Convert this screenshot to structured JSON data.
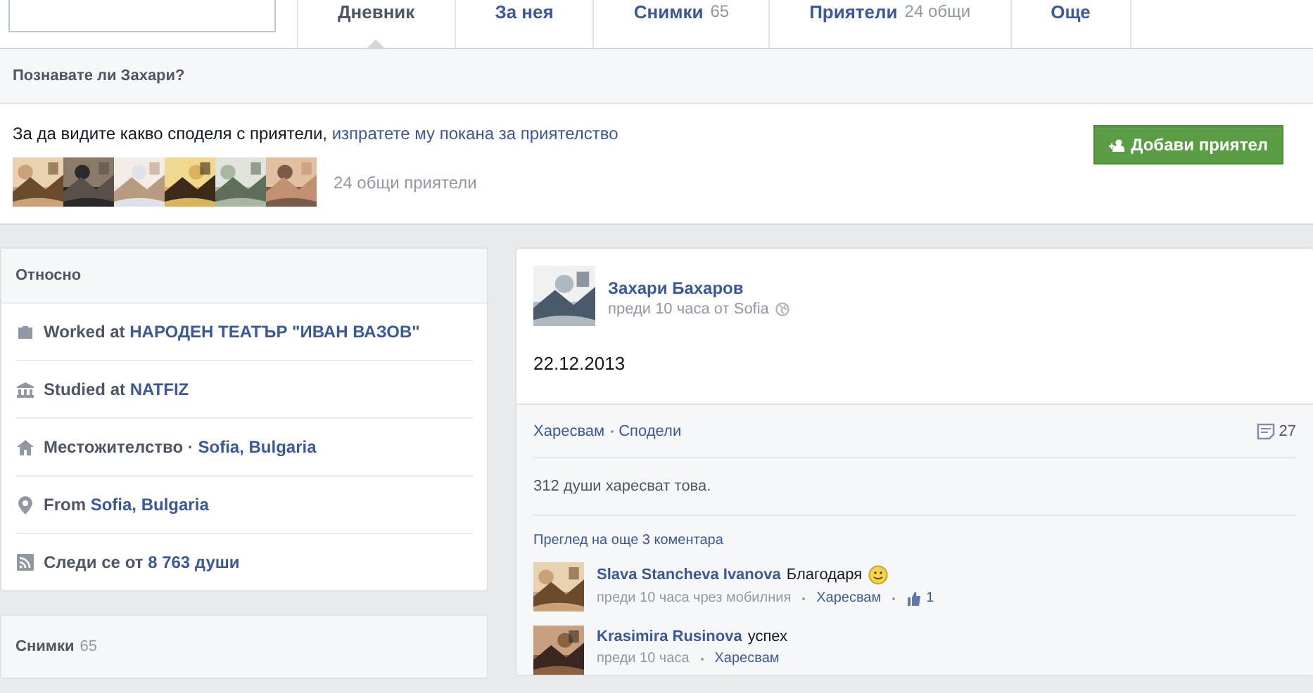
{
  "tabs": [
    {
      "label": "Дневник",
      "selected": true
    },
    {
      "label": "За нея",
      "selected": false
    },
    {
      "label": "Снимки",
      "count": "65",
      "selected": false
    },
    {
      "label": "Приятели",
      "count": "24 общи",
      "selected": false
    },
    {
      "label": "Още",
      "selected": false
    }
  ],
  "know_panel": {
    "title": "Познавате ли Захари?",
    "message": "За да видите какво споделя с приятели,",
    "link": "изпратете му покана за приятелство",
    "button": "Добави приятел",
    "mutual_friends": "24 общи приятели"
  },
  "about": {
    "title": "Относно",
    "items": [
      {
        "kind": "work",
        "text": "Worked at **НАРОДЕН ТЕАТЪР \"ИВАН ВАЗОВ\"**"
      },
      {
        "kind": "school",
        "text": "Studied at **NATFIZ**"
      },
      {
        "kind": "home",
        "text": "Местожителство · **Sofia, Bulgaria**"
      },
      {
        "kind": "pin",
        "text": "From **Sofia, Bulgaria**"
      },
      {
        "kind": "feed",
        "text": "Следи се от **8 763 души**"
      }
    ]
  },
  "photos_card": {
    "title": "Снимки",
    "count": "65"
  },
  "post": {
    "author": "Захари Бахаров",
    "meta": "преди 10 часа от Sofia",
    "text": "22.12.2013",
    "actions": [
      "Харесвам",
      "Сподели"
    ],
    "comment_count": "27",
    "likes": "312 души харесват това.",
    "more_comments": "Преглед на още 3 коментара",
    "comments": [
      {
        "author": "Slava Stancheva Ivanova",
        "text": "Благодаря",
        "smiley": true,
        "meta": "преди 10 часа чрез мобилния",
        "like": "Харесвам",
        "likes": "1"
      },
      {
        "author": "Krasimira Rusinova",
        "text": "успех",
        "smiley": false,
        "meta": "преди 10 часа",
        "like": "Харесвам"
      }
    ]
  }
}
